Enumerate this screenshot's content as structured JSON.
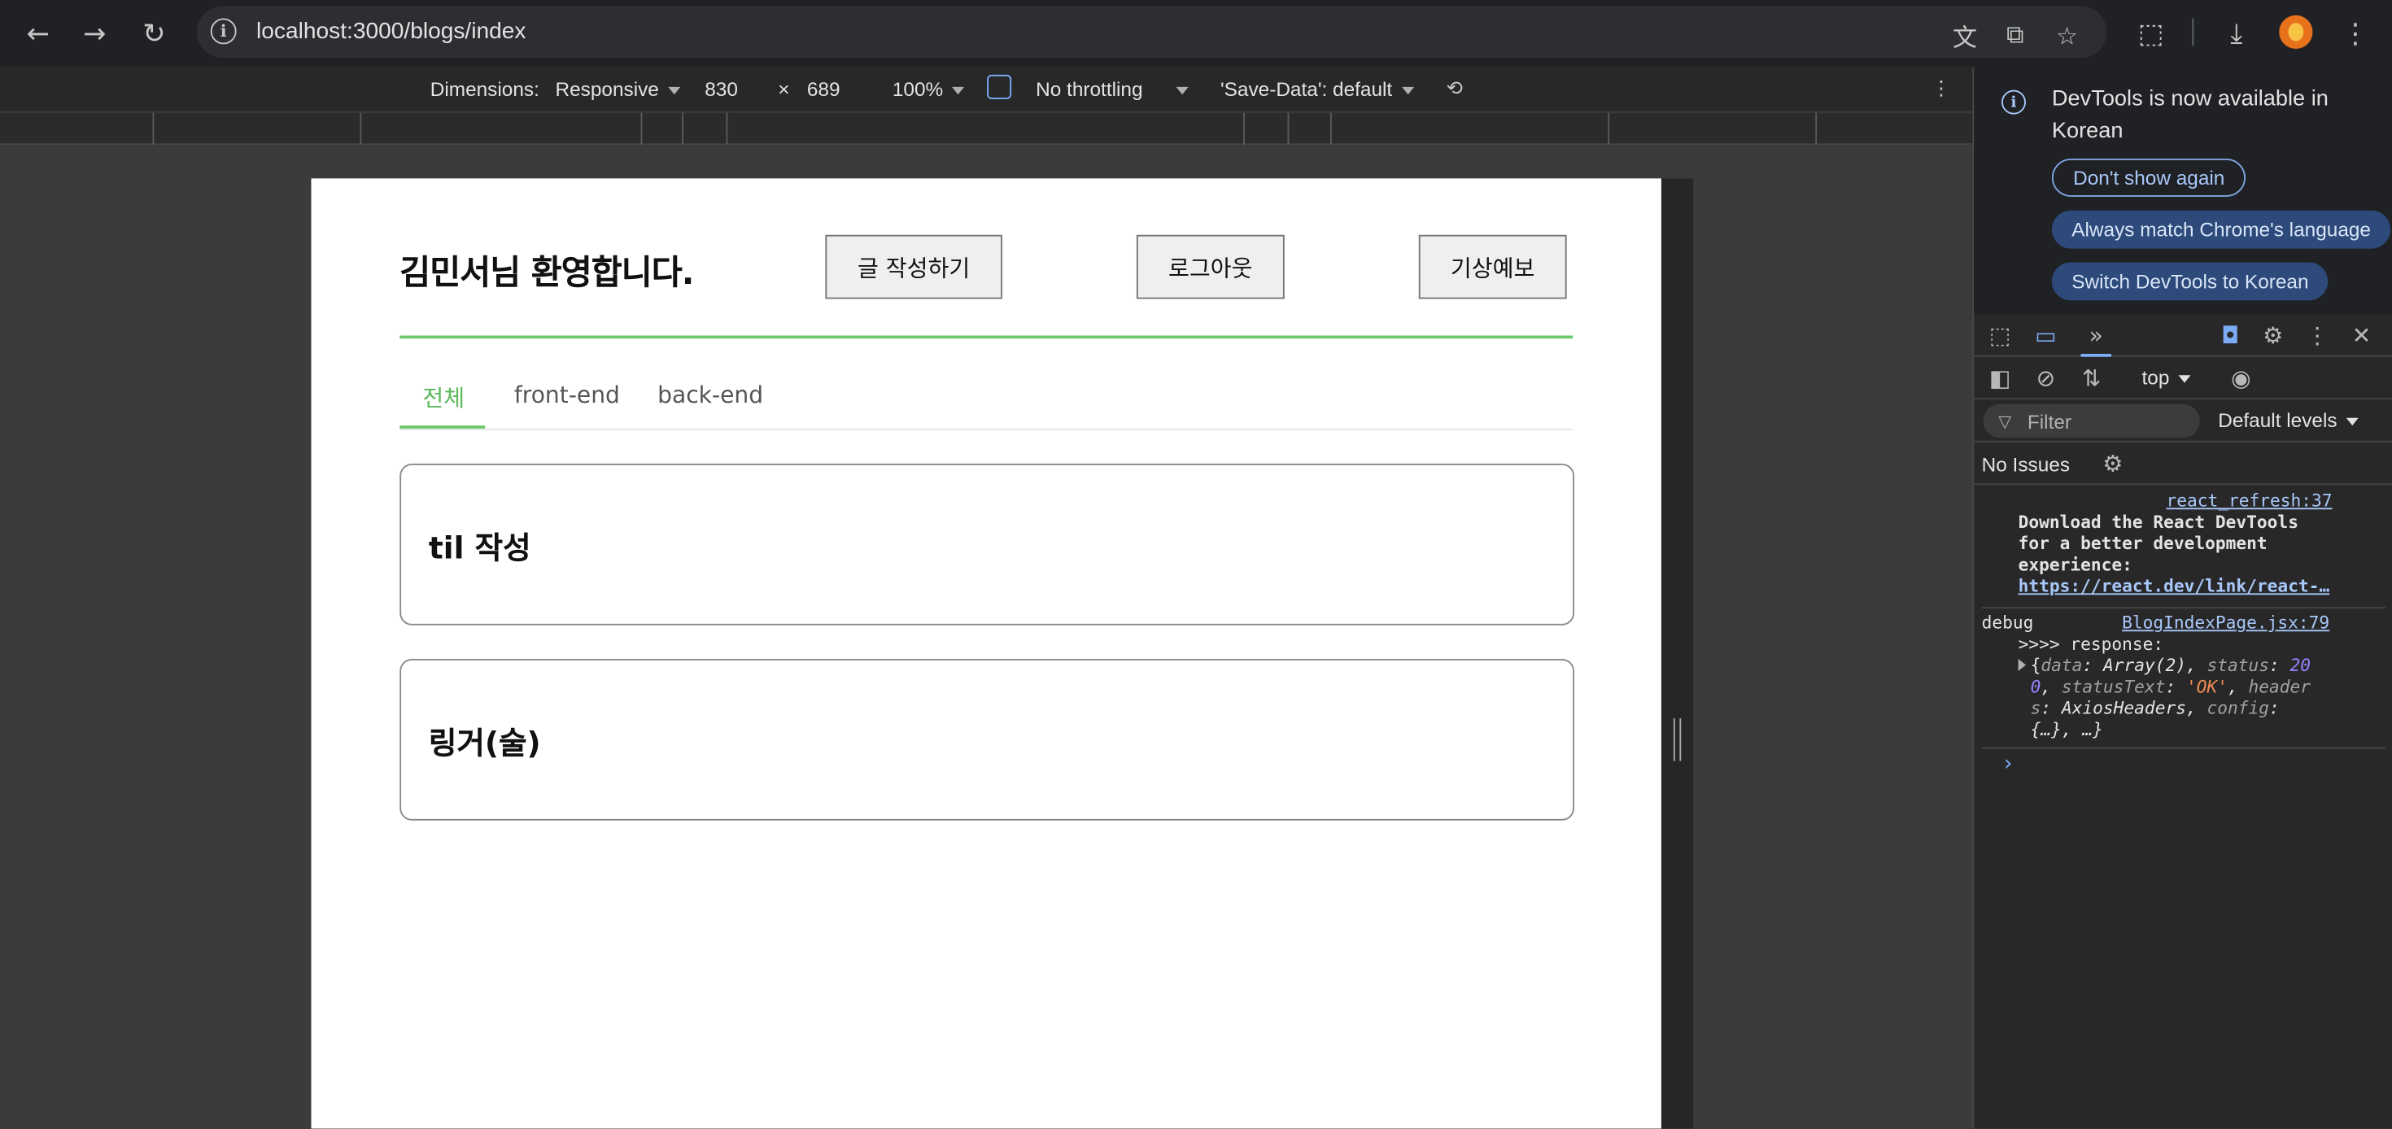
{
  "browser": {
    "url": "localhost:3000/blogs/index"
  },
  "device_toolbar": {
    "dimensions_label": "Dimensions:",
    "device": "Responsive",
    "width": "830",
    "times": "×",
    "height": "689",
    "zoom": "100%",
    "throttling": "No throttling",
    "save_data": "'Save-Data': default"
  },
  "page": {
    "welcome": "김민서님 환영합니다.",
    "buttons": {
      "write": "글 작성하기",
      "logout": "로그아웃",
      "weather": "기상예보"
    },
    "tabs": [
      {
        "label": "전체",
        "active": true
      },
      {
        "label": "front-end",
        "active": false
      },
      {
        "label": "back-end",
        "active": false
      }
    ],
    "cards": [
      {
        "title": "til 작성"
      },
      {
        "title": "링거(술)"
      }
    ]
  },
  "devtools": {
    "notice": {
      "message": "DevTools is now available in Korean",
      "dont_show": "Don't show again",
      "always_match": "Always match Chrome's language",
      "switch": "Switch DevTools to Korean"
    },
    "context": "top",
    "filter_placeholder": "Filter",
    "levels": "Default levels",
    "issues": "No Issues",
    "log": {
      "src1": "react_refresh:37",
      "line1": "Download the React DevTools",
      "line2": "for a better development",
      "line3": "experience:",
      "link1": "https://react.dev/link/react-…",
      "debug": "debug",
      "src2": "BlogIndexPage.jsx:79",
      "response": ">>>> response:",
      "obj_open": "{",
      "k_data": "data",
      "v_data": "Array(2)",
      "k_status": "status",
      "v_status_a": "20",
      "v_status_b": "0",
      "k_statusText": "statusText",
      "v_statusText": "'OK'",
      "k_header_a": "header",
      "k_header_b": "s",
      "v_headers": "AxiosHeaders",
      "k_config": "config",
      "v_config": "{…}, …}",
      "prompt": "›"
    }
  }
}
